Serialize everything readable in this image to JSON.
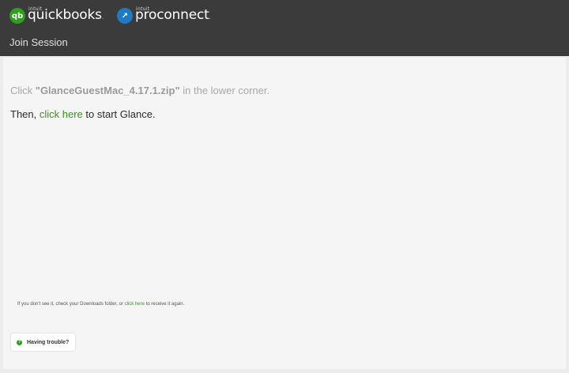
{
  "header": {
    "quickbooks": {
      "icon_name": "quickbooks-logo-icon",
      "icon_glyph": "qb",
      "intuit_label": "intuit",
      "name": "quickbooks",
      "trademark_dot": "."
    },
    "proconnect": {
      "icon_name": "proconnect-logo-icon",
      "icon_glyph": "↗",
      "intuit_label": "intuit",
      "name": "proconnect",
      "trademark_dot": "."
    },
    "subtitle": "Join Session"
  },
  "main": {
    "line1_prefix": "Click ",
    "line1_filename": "\"GlanceGuestMac_4.17.1.zip\"",
    "line1_suffix": " in the lower corner.",
    "line2_prefix": "Then, ",
    "line2_link": "click here",
    "line2_suffix": " to start Glance.",
    "footnote_prefix": "If you don't see it, check your Downloads folder, or ",
    "footnote_link": "click here",
    "footnote_suffix": " to receive it again.",
    "trouble_icon_glyph": "?",
    "trouble_label": "Having trouble?"
  },
  "colors": {
    "header_bg": "#3b3b3b",
    "link_green": "#3e8e2a",
    "quickbooks_green": "#2ca01c",
    "proconnect_blue": "#1f7ac4"
  }
}
